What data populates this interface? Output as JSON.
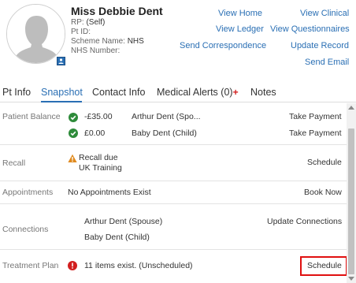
{
  "patient": {
    "name": "Miss Debbie Dent",
    "rp_label": "RP:",
    "rp_value": "(Self)",
    "pt_id_label": "Pt ID:",
    "scheme_label": "Scheme Name:",
    "scheme_value": "NHS",
    "nhs_label": "NHS Number:"
  },
  "header_links": {
    "view_home": "View Home",
    "view_clinical": "View Clinical",
    "view_ledger": "View Ledger",
    "view_questionnaires": "View Questionnaires",
    "send_correspondence": "Send Correspondence",
    "update_record": "Update Record",
    "send_email": "Send Email"
  },
  "tabs": {
    "pt_info": "Pt Info",
    "snapshot": "Snapshot",
    "contact_info": "Contact Info",
    "medical_alerts": "Medical Alerts (0)",
    "notes": "Notes",
    "active": "Snapshot"
  },
  "patient_balance": {
    "label": "Patient Balance",
    "entries": [
      {
        "amount": "-£35.00",
        "name": "Arthur Dent (Spo...",
        "action": "Take Payment"
      },
      {
        "amount": "£0.00",
        "name": "Baby Dent (Child)",
        "action": "Take Payment"
      }
    ]
  },
  "recall": {
    "label": "Recall",
    "status": "Recall due",
    "detail": "UK Training",
    "action": "Schedule"
  },
  "appointments": {
    "label": "Appointments",
    "status": "No Appointments Exist",
    "action": "Book Now"
  },
  "connections": {
    "label": "Connections",
    "items": [
      "Arthur Dent (Spouse)",
      "Baby Dent (Child)"
    ],
    "action": "Update Connections"
  },
  "treatment_plan": {
    "label": "Treatment Plan",
    "status": "11 items exist. (Unscheduled)",
    "action": "Schedule"
  },
  "colors": {
    "link": "#2a6fb4",
    "success": "#2e8b3a",
    "warning": "#e08a1e",
    "error": "#d21f1f",
    "highlight": "#e01010"
  },
  "icons": {
    "avatar": "person-silhouette-icon",
    "badge": "id-card-icon",
    "medical_alert": "red-cross-icon",
    "balance_ok": "check-circle-icon",
    "recall_warning": "warning-triangle-icon",
    "treatment_error": "exclamation-circle-icon"
  }
}
